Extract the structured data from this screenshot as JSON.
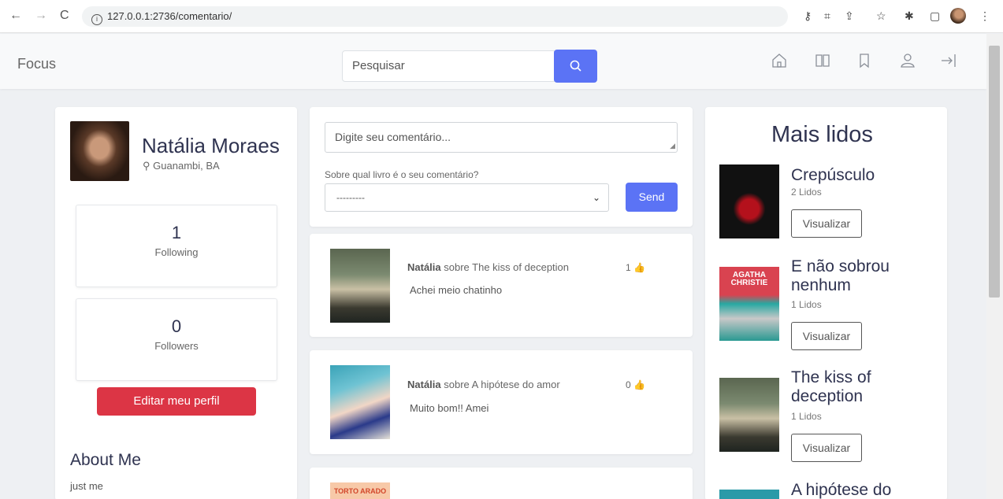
{
  "browser": {
    "url": "127.0.0.1:2736/comentario/"
  },
  "header": {
    "brand": "Focus",
    "search_placeholder": "Pesquisar"
  },
  "profile": {
    "name": "Natália Moraes",
    "location": "Guanambi, BA",
    "following_count": "1",
    "following_label": "Following",
    "followers_count": "0",
    "followers_label": "Followers",
    "edit_button": "Editar meu perfil",
    "about_title": "About Me",
    "about_text": "just me"
  },
  "composer": {
    "placeholder": "Digite seu comentário...",
    "select_label": "Sobre qual livro é o seu comentário?",
    "select_value": "---------",
    "send_button": "Send"
  },
  "posts": [
    {
      "user": "Natália",
      "about": "sobre The kiss of deception",
      "text": "Achei meio chatinho",
      "likes": "1"
    },
    {
      "user": "Natália",
      "about": "sobre A hipótese do amor",
      "text": "Muito bom!! Amei",
      "likes": "0"
    },
    {
      "cover_text": "TORTO ARADO"
    }
  ],
  "most_read": {
    "title": "Mais lidos",
    "view_button": "Visualizar",
    "books": [
      {
        "title": "Crepúsculo",
        "reads": "2 Lidos"
      },
      {
        "title_line1": "E não sobrou",
        "title_line2": "nenhum",
        "reads": "1 Lidos",
        "cover_text": "AGATHA CHRISTIE"
      },
      {
        "title_line1": "The kiss of",
        "title_line2": "deception",
        "reads": "1 Lidos"
      },
      {
        "title_line1": "A hipótese do"
      }
    ]
  },
  "colors": {
    "primary": "#5b73f5",
    "danger": "#dc3545",
    "heading": "#2f3350"
  }
}
